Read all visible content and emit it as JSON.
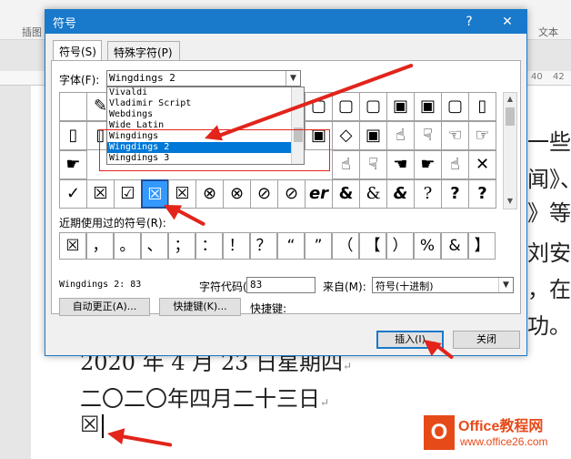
{
  "ribbon": {
    "left_label": "插图",
    "right_label": "文本"
  },
  "ruler": {
    "numbers": [
      "40",
      "42"
    ]
  },
  "document": {
    "lines": [
      {
        "text": "一些"
      },
      {
        "text": "闻》、"
      },
      {
        "text": "》等"
      },
      {
        "text": "刘安"
      },
      {
        "text": "，在"
      },
      {
        "text": "功。"
      }
    ],
    "date_line": "2020 年 4 月 23 日星期四",
    "chinese_date": "二〇二〇年四月二十三日",
    "inserted_symbol": "☒",
    "para_mark": "↵"
  },
  "dialog": {
    "title": "符号",
    "help": "?",
    "close": "✕",
    "tabs": [
      "符号(S)",
      "特殊字符(P)"
    ],
    "font_label": "字体(F):",
    "font_value": "Wingdings 2",
    "font_options": [
      "Vivaldi",
      "Vladimir Script",
      "Webdings",
      "Wide Latin",
      "Wingdings",
      "Wingdings 2",
      "Wingdings 3"
    ],
    "symbol_rows": [
      [
        "",
        "✎",
        "",
        "",
        "",
        "",
        "",
        "",
        "",
        "",
        "",
        "",
        "",
        "",
        "",
        ""
      ],
      [
        "▯",
        "▯",
        "",
        "",
        "",
        "",
        "",
        "",
        "",
        "▣",
        "◇",
        "☝",
        "☟",
        "☜",
        "☞",
        ""
      ],
      [
        "☛",
        "",
        "",
        "",
        "",
        "",
        "",
        "",
        "",
        "",
        "",
        "☝",
        "☟",
        "☚",
        "☛",
        "✕"
      ],
      [
        "✓",
        "☒",
        "☑",
        "☒",
        "☒",
        "⊗",
        "⊗",
        "⊘",
        "⊘",
        "er",
        "&",
        "&",
        "&",
        "?",
        "?",
        "?"
      ]
    ],
    "row1_right": [
      "",
      "",
      "▢",
      "▢",
      "▢",
      "▣",
      "▣",
      "▯"
    ],
    "recent_label": "近期使用过的符号(R):",
    "recent_symbols": [
      "☒",
      "，",
      "。",
      "、",
      "；",
      "：",
      "！",
      "？",
      "“",
      "”",
      "（",
      "【",
      "）",
      "%",
      "&",
      "】"
    ],
    "char_name": "Wingdings 2: 83",
    "code_label": "字符代码(C):",
    "code_value": "83",
    "from_label": "来自(M):",
    "from_value": "符号(十进制)",
    "autocorrect_button": "自动更正(A)...",
    "shortcut_button": "快捷键(K)...",
    "shortcut_label": "快捷键:",
    "insert_button": "插入(I)",
    "close_button": "关闭"
  },
  "watermark": {
    "title": "Office教程网",
    "url": "www.office26.com",
    "logo": "O"
  },
  "colors": {
    "accent": "#1979ca",
    "selection": "#0078d7",
    "annotation": "#e2241b",
    "watermark": "#e64a19"
  }
}
